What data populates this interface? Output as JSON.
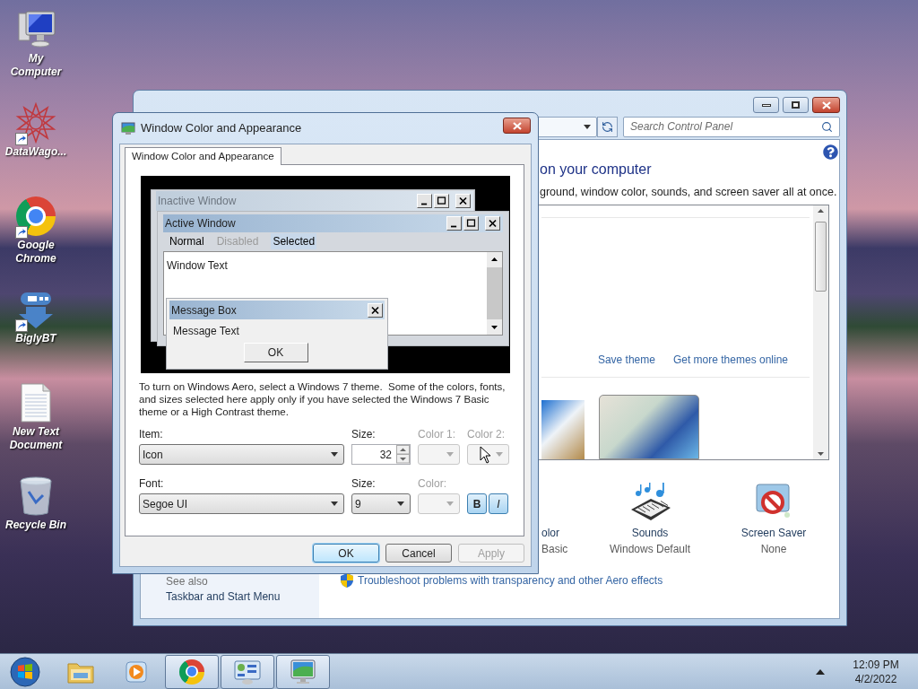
{
  "desktop_icons": [
    {
      "label": "My Computer",
      "kind": "computer",
      "shortcut": false
    },
    {
      "label": "DataWago...",
      "kind": "star",
      "shortcut": true
    },
    {
      "label": "Google Chrome",
      "kind": "chrome",
      "shortcut": true
    },
    {
      "label": "BiglyBT",
      "kind": "bigly",
      "shortcut": true
    },
    {
      "label": "New Text Document",
      "kind": "textdoc",
      "shortcut": false
    },
    {
      "label": "Recycle Bin",
      "kind": "recycle",
      "shortcut": false
    }
  ],
  "control_panel": {
    "search_placeholder": "Search Control Panel",
    "heading": "on your computer",
    "description": "ground, window color, sounds, and screen saver all at once.",
    "links": [
      "Save theme",
      "Get more themes online"
    ],
    "items": [
      {
        "label": "olor",
        "sublabel": "Basic",
        "kind": "partial"
      },
      {
        "label": "Sounds",
        "sublabel": "Windows Default",
        "kind": "sounds"
      },
      {
        "label": "Screen Saver",
        "sublabel": "None",
        "kind": "screensaver"
      }
    ],
    "see_also": "See also",
    "sidebar_links": [
      "Taskbar and Start Menu"
    ],
    "troubleshoot": "Troubleshoot problems with transparency and other Aero effects"
  },
  "dialog": {
    "title": "Window Color and Appearance",
    "tabs": [
      {
        "label": "Window Color and Appearance",
        "selected": true
      }
    ],
    "preview": {
      "inactive_title": "Inactive Window",
      "active_title": "Active Window",
      "menu": [
        {
          "label": "Normal",
          "disabled": false,
          "selected": false
        },
        {
          "label": "Disabled",
          "disabled": true,
          "selected": false
        },
        {
          "label": "Selected",
          "disabled": false,
          "selected": true
        }
      ],
      "window_text": "Window Text",
      "message_title": "Message Box",
      "message_text": "Message Text",
      "ok": "OK"
    },
    "info": "To turn on Windows Aero, select a Windows 7 theme.  Some of the colors, fonts, and sizes selected here apply only if you have selected the Windows 7 Basic theme or a High Contrast theme.",
    "rows": [
      {
        "fields": [
          {
            "kind": "dropdown",
            "label": "Item:",
            "value": "Icon",
            "disabled": false
          },
          {
            "kind": "spinner",
            "label": "Size:",
            "value": "32",
            "disabled": false
          },
          {
            "kind": "color",
            "label": "Color 1:",
            "disabled": true
          },
          {
            "kind": "color",
            "label": "Color 2:",
            "disabled": true
          }
        ]
      },
      {
        "fields": [
          {
            "kind": "dropdown",
            "label": "Font:",
            "value": "Segoe UI",
            "disabled": false
          },
          {
            "kind": "dropdown",
            "label": "Size:",
            "value": "9",
            "disabled": false
          },
          {
            "kind": "color",
            "label": "Color:",
            "disabled": true
          },
          {
            "kind": "styles",
            "buttons": [
              {
                "label": "B",
                "kind": "bold"
              },
              {
                "label": "I",
                "kind": "italic"
              }
            ]
          }
        ]
      }
    ],
    "buttons": [
      {
        "label": "OK",
        "kind": "default",
        "disabled": false
      },
      {
        "label": "Cancel",
        "kind": "normal",
        "disabled": false
      },
      {
        "label": "Apply",
        "kind": "normal",
        "disabled": true
      }
    ]
  },
  "taskbar": {
    "apps": [
      {
        "kind": "explorer",
        "open": false
      },
      {
        "kind": "media",
        "open": false
      },
      {
        "kind": "chrome",
        "open": true
      },
      {
        "kind": "control",
        "open": true
      },
      {
        "kind": "display",
        "open": true
      }
    ],
    "time": "12:09 PM",
    "date": "4/2/2022"
  }
}
